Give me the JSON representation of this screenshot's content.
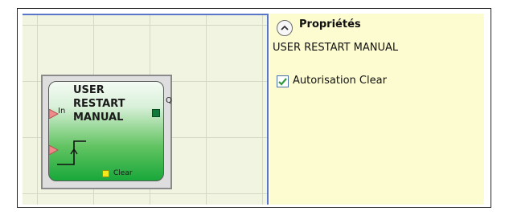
{
  "block": {
    "title_lines": [
      "USER",
      "RESTART",
      "MANUAL"
    ],
    "input_label": "In",
    "output_label": "Q",
    "clear_label": "Clear"
  },
  "properties": {
    "title": "Propriétés",
    "subtitle": "USER RESTART MANUAL",
    "checkbox_label": "Autorisation Clear",
    "checkbox_checked": true
  },
  "colors": {
    "canvas_bg": "#f1f4e1",
    "panel_bg": "#fdfbd0",
    "block_green": "#19a83a",
    "input_port": "#f08a8a",
    "output_port": "#107a3a",
    "clear_port": "#f3e81a",
    "check_green": "#2e9a3a"
  },
  "icons": {
    "collapse": "chevron-up-icon",
    "input_port": "triangle-port-icon",
    "output_port": "square-port-icon",
    "clear_port": "square-port-icon",
    "checkbox": "check-icon"
  }
}
